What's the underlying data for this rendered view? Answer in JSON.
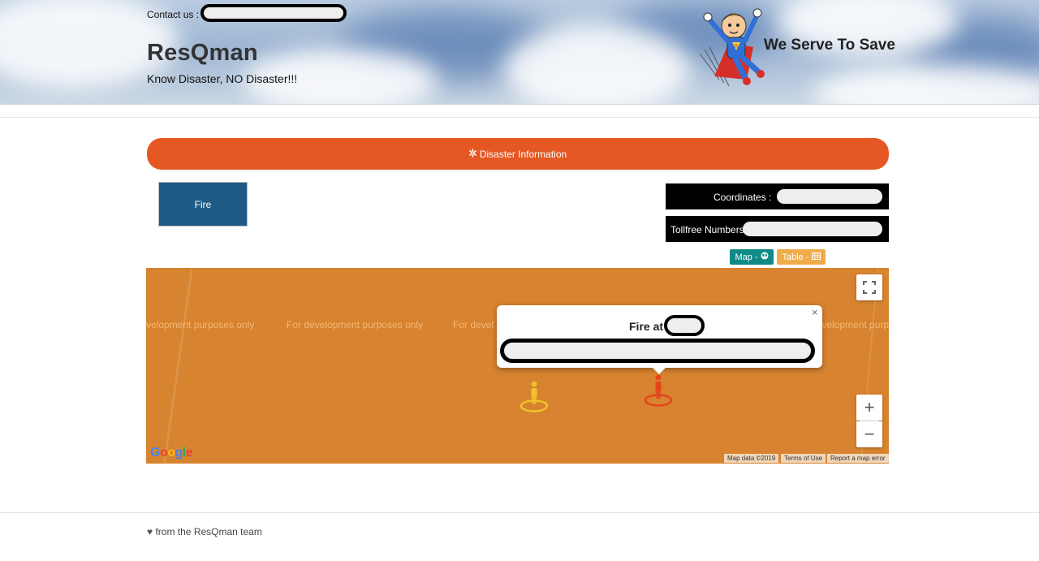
{
  "header": {
    "contact_label": "Contact us :",
    "brand_title": "ResQman",
    "tagline": "Know Disaster, NO Disaster!!!",
    "slogan": "We Serve To Save",
    "mascot_icon": "superhero-mascot-icon"
  },
  "banner": {
    "icon": "asterisk-icon",
    "label": "Disaster Information"
  },
  "disaster_types": [
    {
      "label": "Fire"
    }
  ],
  "info": {
    "coordinates_label": "Coordinates :",
    "tollfree_label": "Tollfree Numbers"
  },
  "view_toggles": {
    "map_label": "Map - ",
    "map_icon": "globe-icon",
    "table_label": "Table - ",
    "table_icon": "table-grid-icon"
  },
  "map": {
    "watermark": "For development purposes only",
    "watermark_partial_left": "velopment purposes only",
    "watermark_partial_mid": "For devel",
    "watermark_partial_right": "development purpo",
    "google_logo": "Google",
    "attribution": {
      "map_data": "Map data ©2019",
      "terms": "Terms of Use",
      "report": "Report a map error"
    },
    "zoom_in": "+",
    "zoom_out": "−",
    "markers": [
      {
        "name": "yellow-person-marker",
        "color": "#f2c12e"
      },
      {
        "name": "red-person-marker",
        "color": "#e8421c"
      }
    ],
    "infowindow": {
      "title": "Fire at",
      "close": "×"
    }
  },
  "footer": {
    "heart": "♥",
    "text": "from the ResQman team"
  },
  "colors": {
    "banner": "#e55823",
    "fire_tile": "#1d5a86",
    "map_toggle": "#0f8a86",
    "table_toggle": "#f0ac4a",
    "map_background": "#d7832f"
  }
}
